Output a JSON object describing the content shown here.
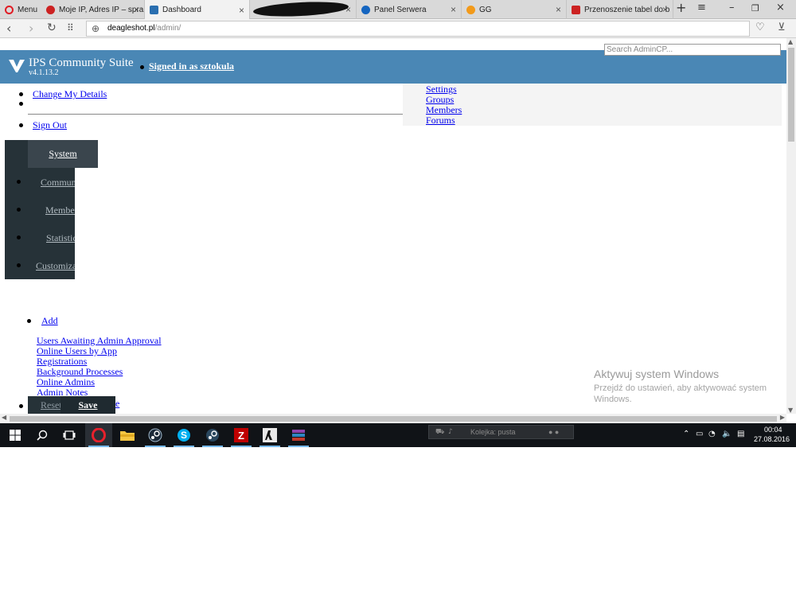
{
  "browser": {
    "menu_label": "Menu",
    "tabs": [
      {
        "label": "Moje IP, Adres IP – spra",
        "color": "#cc2222"
      },
      {
        "label": "Dashboard",
        "color": "#2a6fb0"
      },
      {
        "label": "",
        "color": "#111111"
      },
      {
        "label": "Panel Serwera",
        "color": "#1565c0"
      },
      {
        "label": "GG",
        "color": "#f29a1a"
      },
      {
        "label": "Przenoszenie tabel do b",
        "color": "#cc2222"
      }
    ],
    "url_host": "deagleshot.pl",
    "url_path": "/admin/"
  },
  "acp": {
    "suite_name": "IPS Community Suite",
    "version": "v4.1.13.2",
    "signed_in": "Signed in as sztokula",
    "search_placeholder": "Search AdminCP...",
    "user_menu": {
      "change_details": "Change My Details",
      "sign_out": "Sign Out"
    },
    "quick_links": [
      "Settings",
      "Groups",
      "Members",
      "Forums"
    ],
    "nav": {
      "system": "System",
      "community": "Community",
      "members": "Members",
      "stats": "Statistics",
      "customize": "Customization"
    },
    "add_label": "Add",
    "blocks": [
      "Users Awaiting Admin Approval",
      "Online Users by App",
      "Registrations",
      "Background Processes",
      "Online Admins",
      "Admin Notes"
    ],
    "reset_label": "Reset",
    "save_label": "Save",
    "tail_text": "e"
  },
  "watermark": {
    "title": "Aktywuj system Windows",
    "subtitle": "Przejdź do ustawień, aby aktywować system Windows."
  },
  "taskbar": {
    "queue_text": "Kolejka: pusta",
    "time": "00:04",
    "date": "27.08.2016"
  },
  "colors": {
    "header": "#4a87b5",
    "nav_dark": "#263238",
    "link": "#0000ee"
  }
}
